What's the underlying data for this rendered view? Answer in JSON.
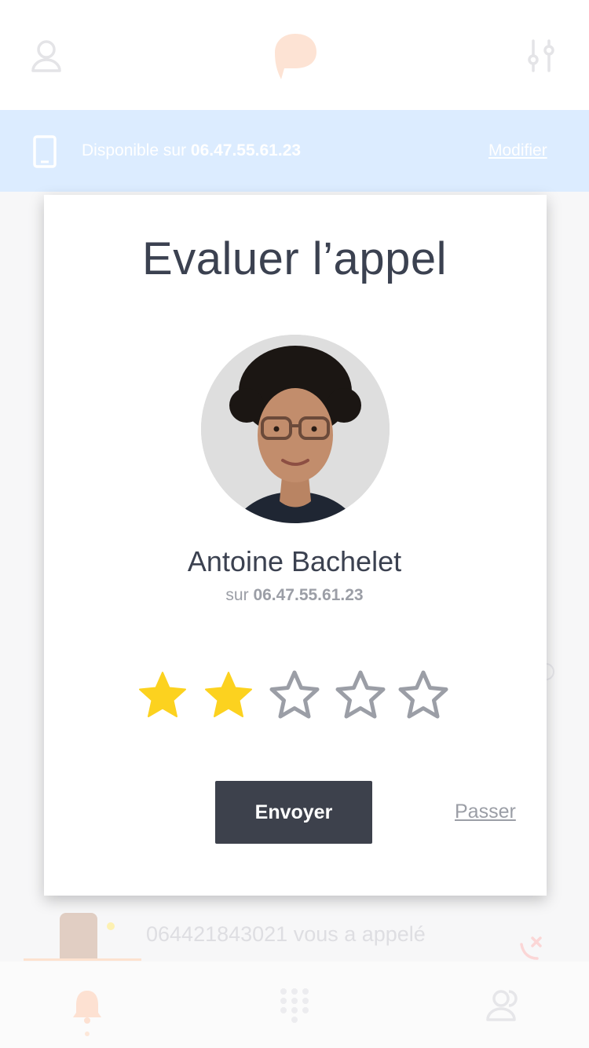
{
  "header": {
    "profile_icon": "user-icon",
    "logo_icon": "app-logo",
    "settings_icon": "sliders-icon"
  },
  "availability": {
    "icon": "smartphone-icon",
    "prefix": "Disponible sur",
    "number": "06.47.55.61.23",
    "edit_label": "Modifier"
  },
  "background_list": {
    "recent_call": {
      "text": "064421843021 vous a appelé",
      "sub": "",
      "icon": "missed-call-icon"
    }
  },
  "modal": {
    "title": "Evaluer l’appel",
    "contact_name": "Antoine Bachelet",
    "contact_prefix": "sur",
    "contact_number": "06.47.55.61.23",
    "rating": {
      "value": 2,
      "max": 5,
      "filled_color": "#fcd21f",
      "empty_color": "#9b9ea6"
    },
    "send_label": "Envoyer",
    "skip_label": "Passer"
  },
  "bottom_nav": {
    "items": [
      {
        "icon": "bell-icon",
        "active": true
      },
      {
        "icon": "dialpad-icon",
        "active": false
      },
      {
        "icon": "contacts-icon",
        "active": false
      }
    ]
  },
  "colors": {
    "accent": "#f47f3f",
    "primary_button": "#3d414c",
    "availability_bar": "#dcecff"
  }
}
